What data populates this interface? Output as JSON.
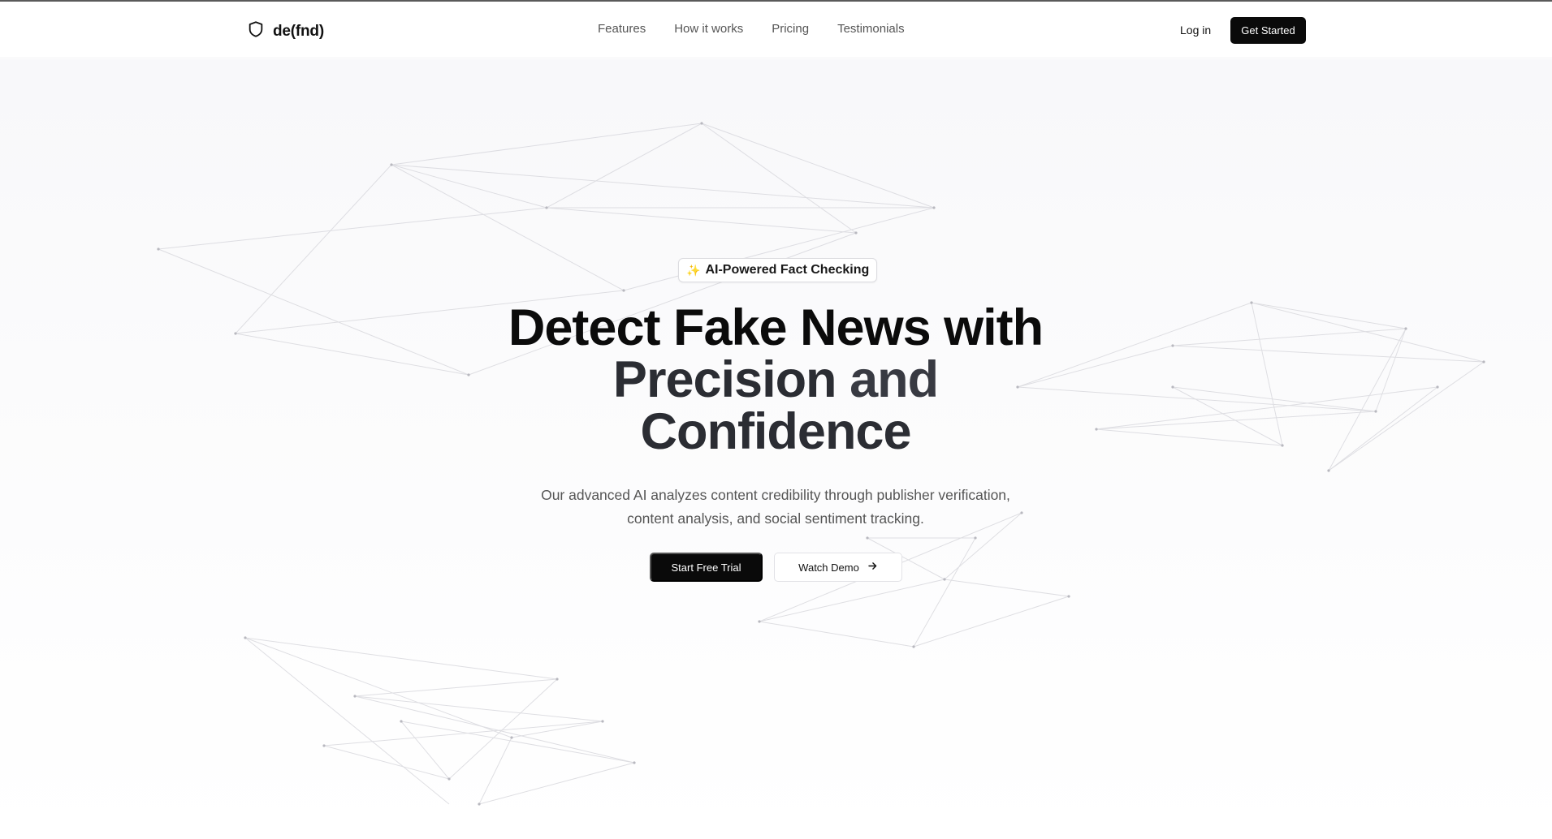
{
  "brand": {
    "name": "de(fnd)",
    "icon": "shield-icon"
  },
  "nav": {
    "links": [
      "Features",
      "How it works",
      "Pricing",
      "Testimonials"
    ],
    "login_label": "Log in",
    "cta_label": "Get Started"
  },
  "hero": {
    "badge": {
      "icon": "sparkle-icon",
      "label": "AI-Powered Fact Checking"
    },
    "headline_line1": "Detect Fake News with",
    "headline_line2a": "Precision",
    "headline_line2b": "and",
    "headline_line3": "Confidence",
    "subtext_line1": "Our advanced AI analyzes content credibility through publisher verification,",
    "subtext_line2": "content analysis, and social sentiment tracking.",
    "primary_cta": "Start Free Trial",
    "secondary_cta": "Watch Demo",
    "secondary_icon": "arrow-right-icon"
  },
  "colors": {
    "primary": "#0a0a0a",
    "text": "#111111",
    "muted": "#555555",
    "background": "#ffffff"
  }
}
